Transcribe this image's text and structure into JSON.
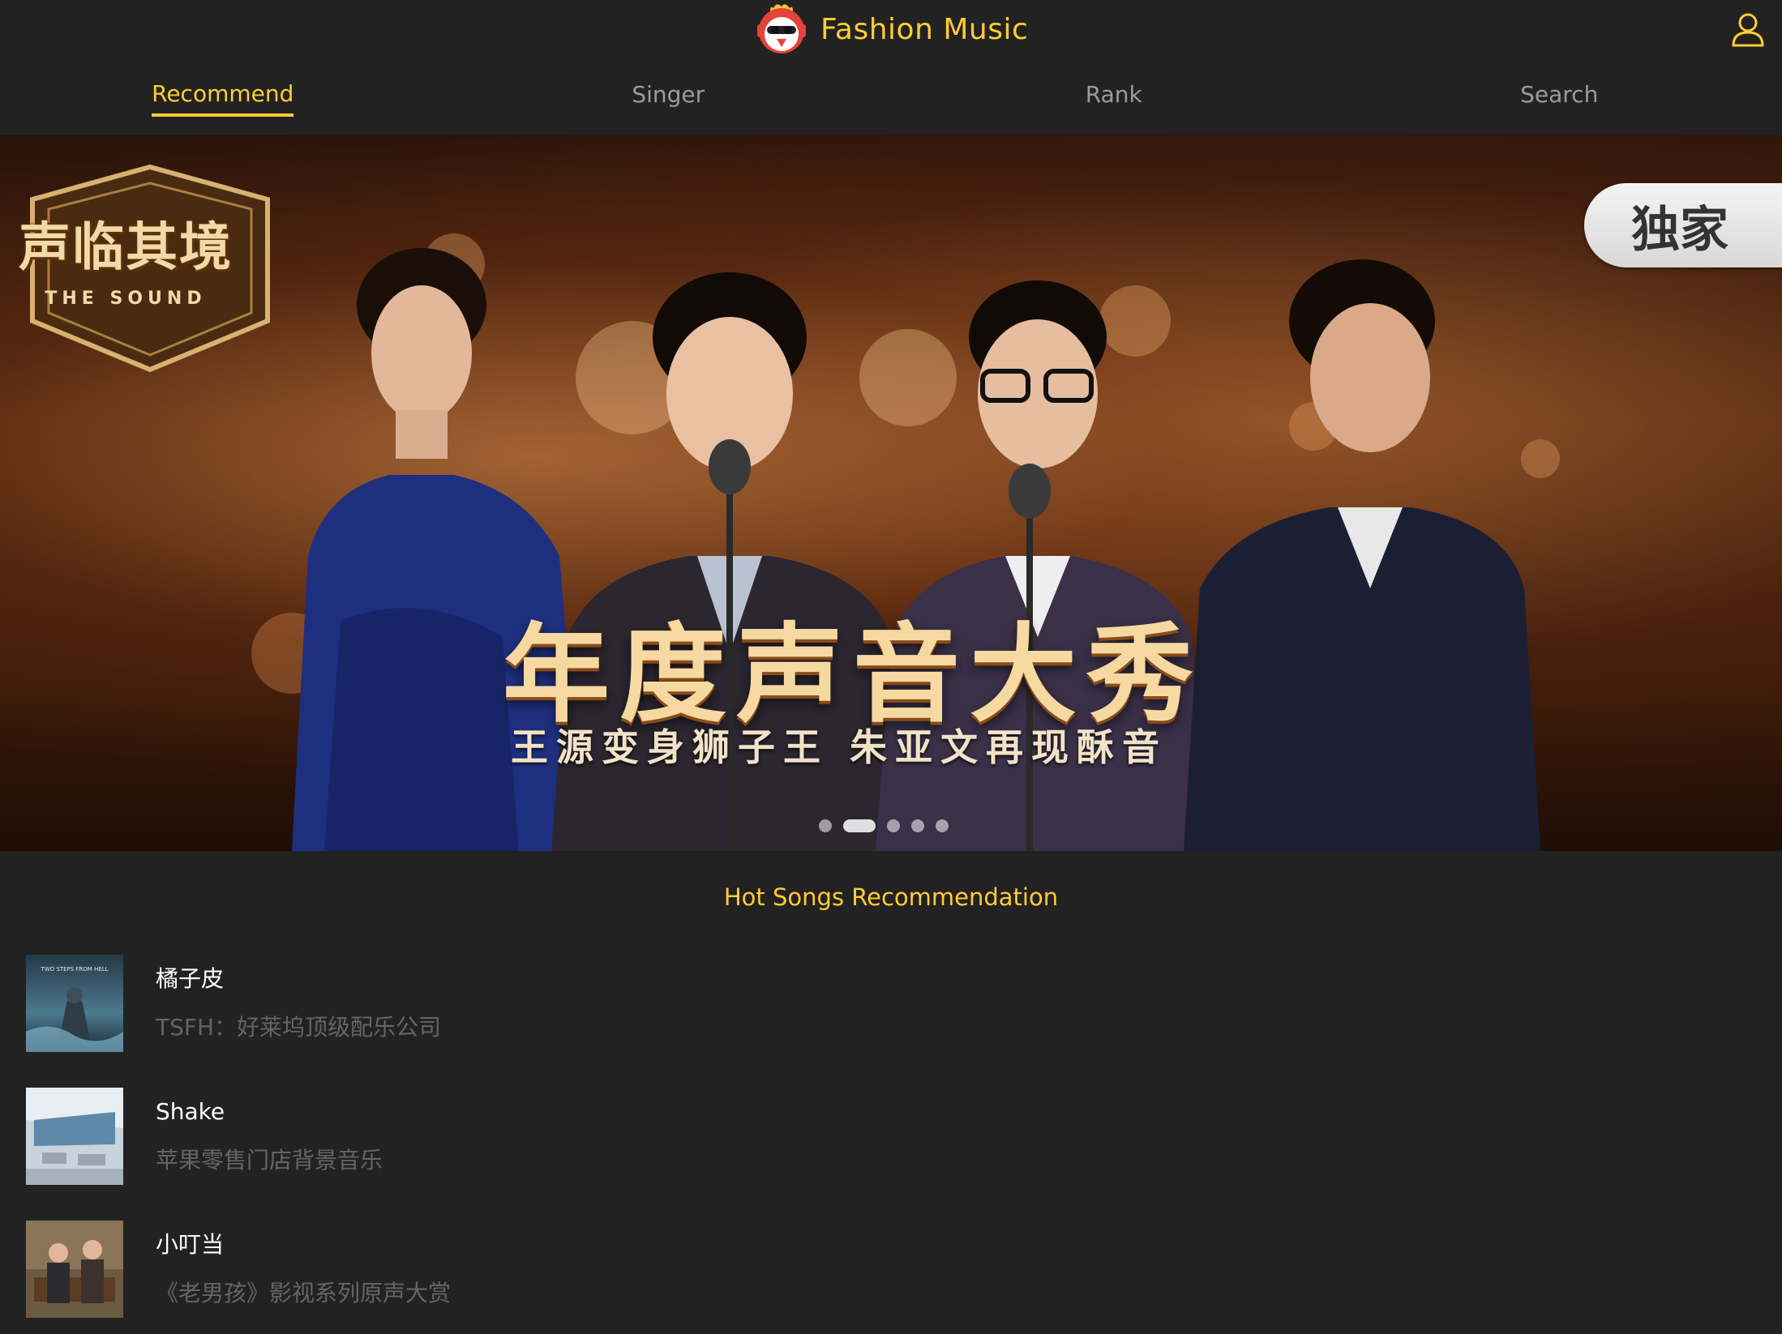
{
  "header": {
    "title": "Fashion Music",
    "logo_icon": "rooster-mascot-icon",
    "user_icon": "user-icon",
    "accent_color": "#ffcd32"
  },
  "tabs": [
    {
      "label": "Recommend",
      "active": true
    },
    {
      "label": "Singer",
      "active": false
    },
    {
      "label": "Rank",
      "active": false
    },
    {
      "label": "Search",
      "active": false
    }
  ],
  "banner": {
    "show_logo_cn": "声临其境",
    "show_logo_en": "THE SOUND",
    "badge": "独家",
    "headline": "年度声音大秀",
    "subline": "王源变身狮子王 朱亚文再现酥音",
    "slide_count": 5,
    "active_slide": 2
  },
  "hot_songs": {
    "title": "Hot Songs Recommendation",
    "items": [
      {
        "name": "橘子皮",
        "desc": "TSFH：好莱坞顶级配乐公司",
        "cover_text": "TWO STEPS FROM HELL"
      },
      {
        "name": "Shake",
        "desc": "苹果零售门店背景音乐",
        "cover_text": ""
      },
      {
        "name": "小叮当",
        "desc": "《老男孩》影视系列原声大赏",
        "cover_text": ""
      }
    ]
  }
}
